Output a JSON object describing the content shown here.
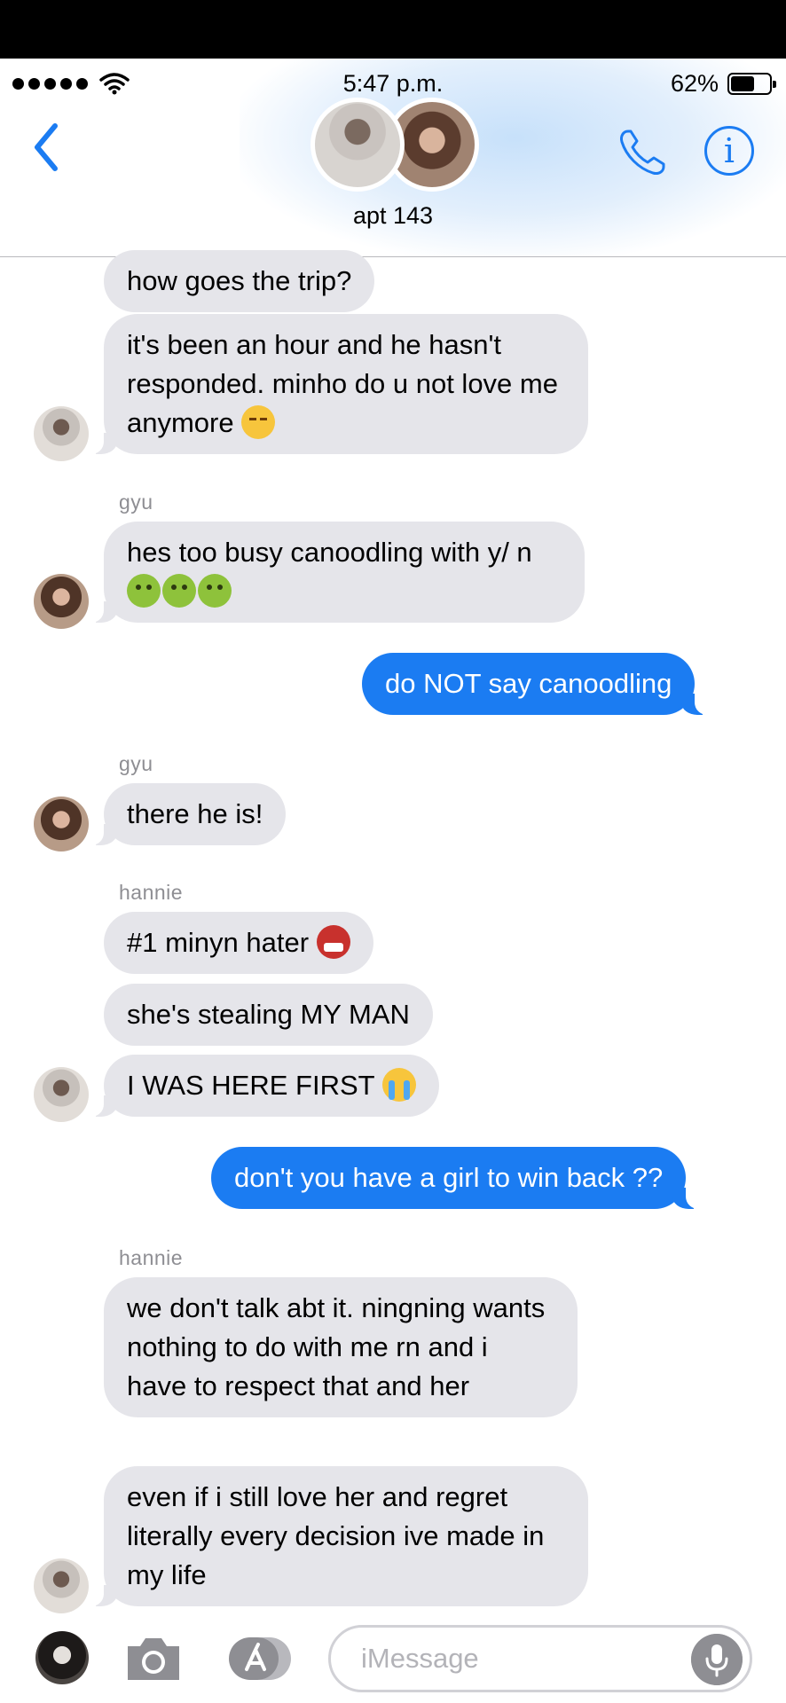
{
  "status_bar": {
    "time": "5:47 p.m.",
    "battery": "62%",
    "battery_level": 0.62,
    "signal_bars": 5
  },
  "header": {
    "title": "apt 143"
  },
  "messages": [
    {
      "text": "how goes the trip?"
    },
    {
      "text": "it's been an hour and he hasn't responded. minho do u not love me anymore",
      "emojis": [
        "disappointed-face-emoji"
      ]
    },
    {
      "sender": "gyu",
      "text": "hes too busy canoodling with y/ n",
      "emojis": [
        "nauseated-face-emoji",
        "nauseated-face-emoji",
        "nauseated-face-emoji"
      ]
    },
    {
      "text": "do NOT say canoodling"
    },
    {
      "sender": "gyu",
      "text": "there he is!"
    },
    {
      "sender": "hannie",
      "text": "#1 minyn hater",
      "emojis": [
        "ogre-emoji"
      ]
    },
    {
      "text": "she's stealing MY MAN"
    },
    {
      "text": "I WAS HERE FIRST",
      "emojis": [
        "loudly-crying-face-emoji"
      ]
    },
    {
      "text": "don't you have a girl to win back ??"
    },
    {
      "sender": "hannie",
      "text": "we don't talk abt it. ningning wants nothing to do with me rn and i have to respect that and her"
    },
    {
      "text": "even if i still love her and regret literally every decision ive made in my life"
    }
  ],
  "composer": {
    "placeholder": "iMessage"
  },
  "colors": {
    "accent": "#1b7cf2",
    "incoming_bubble": "#e5e5ea",
    "sender_label": "#8e8e93"
  }
}
